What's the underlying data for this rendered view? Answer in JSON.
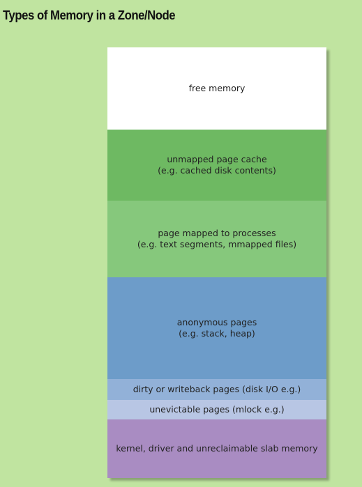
{
  "title": "Types of Memory in a Zone/Node",
  "segments": {
    "free": {
      "line1": "free memory"
    },
    "unmapped": {
      "line1": "unmapped page cache",
      "line2": "(e.g. cached disk contents)"
    },
    "mapped": {
      "line1": "page mapped to processes",
      "line2": "(e.g. text segments, mmapped files)"
    },
    "anon": {
      "line1": "anonymous pages",
      "line2": "(e.g. stack, heap)"
    },
    "dirty": {
      "line1": "dirty or writeback pages (disk I/O e.g.)"
    },
    "unevictable": {
      "line1": "unevictable pages (mlock e.g.)"
    },
    "kernel": {
      "line1": "kernel, driver and unreclaimable slab memory"
    }
  },
  "colors": {
    "background": "#c0e4a0",
    "free": "#ffffff",
    "unmapped": "#6eb962",
    "mapped": "#86c87c",
    "anon": "#6d9cc9",
    "dirty": "#92b1d8",
    "unevictable": "#b8c6e4",
    "kernel": "#a98cc2"
  }
}
